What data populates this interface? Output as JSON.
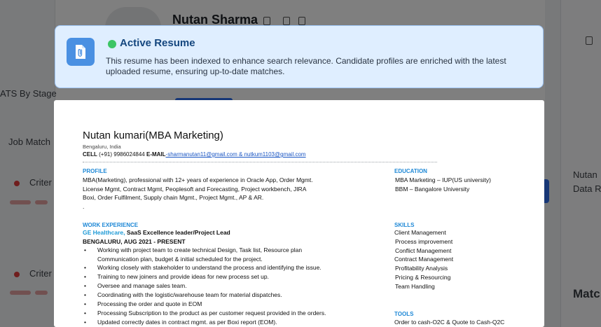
{
  "background": {
    "profile_name": "Nutan Sharma",
    "ats_label": "ATS By Stage",
    "job_match_label": "Job Match",
    "criteria_label": "Criter",
    "right_name": "Nutan",
    "right_sub": "Data R",
    "match_label": "Matc"
  },
  "banner": {
    "title": "Active Resume",
    "message": "This resume has been indexed to enhance search relevance. Candidate profiles are enriched with the latest uploaded resume, ensuring up-to-date matches.",
    "icon": "attachment-file-icon",
    "status_color": "#3cc564"
  },
  "resume": {
    "name": "Nutan kumari(MBA Marketing)",
    "location": "Bengaluru, India",
    "cell_label": "CELL",
    "cell_value": "(+91) 9986024844",
    "email_label": "E-MAIL",
    "email_value": "-sharmanutan11@gmail.com & nutkum1103@gmail.com",
    "profile": {
      "heading": "PROFILE",
      "lines": [
        "MBA(Marketing), professional with 12+ years of experience in Oracle App, Order Mgmt.",
        "License Mgmt, Contract Mgmt, Peoplesoft and Forecasting, Project workbench, JIRA",
        "Boxi, Order Fulfilment, Supply chain Mgmt., Project Mgmt., AP & AR.",
        "."
      ]
    },
    "work": {
      "heading": "WORK EXPERIENCE",
      "company": "GE Healthcare,",
      "role": " SaaS Excellence leader/Project Lead",
      "location_date": "BENGALURU, AUG 2021 - PRESENT",
      "bullets": [
        "Working with project team to create technical Design, Task list, Resource plan",
        "Communication plan, budget & initial scheduled for the project.",
        "Working closely with stakeholder to understand the process and identifying the issue.",
        "Training to new joiners and provide ideas for new process set up.",
        "Oversee and manage sales team.",
        "Coordinating with the logistic/warehouse team for material dispatches.",
        "Processing the order and quote in EOM",
        "Processing Subscription to the product as per customer request provided in the orders.",
        "Updated correctly dates in contract mgmt. as per Boxi report (EOM)."
      ]
    },
    "education": {
      "heading": "EDUCATION",
      "items": [
        "MBA Marketing – IUP(US university)",
        "BBM – Bangalore University"
      ]
    },
    "skills": {
      "heading": "SKILLS",
      "items": [
        "Client Management",
        "Process improvement",
        "Conflict Management",
        "Contract Management",
        "Profitability Analysis",
        "Pricing & Resourcing",
        "Team Handling"
      ]
    },
    "tools": {
      "heading": "TOOLS",
      "items": [
        "Order to cash-O2C & Quote to Cash-Q2C"
      ]
    }
  }
}
